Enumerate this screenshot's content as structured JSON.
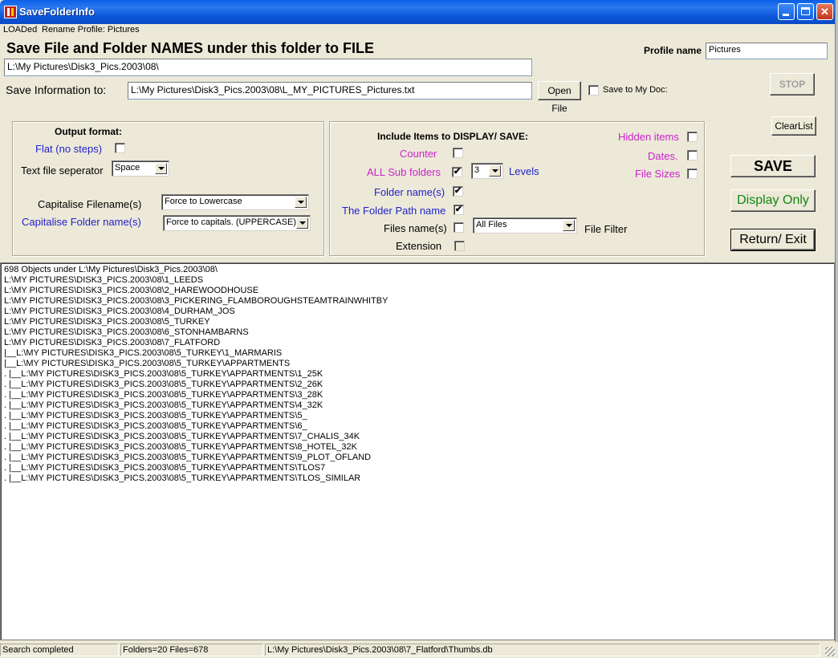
{
  "window": {
    "title": "SaveFolderInfo"
  },
  "menu": {
    "items": [
      "LOADed",
      "Rename Profile: Pictures"
    ]
  },
  "header": {
    "big_title": "Save File and Folder NAMES under this folder to FILE",
    "folder_path": "L:\\My Pictures\\Disk3_Pics.2003\\08\\",
    "save_info_label": "Save  Information to:",
    "save_info_value": "L:\\My Pictures\\Disk3_Pics.2003\\08\\L_MY_PICTURES_Pictures.txt",
    "open_file_label": "Open File",
    "save_to_mydoc_label": "Save to My Doc:",
    "profile_name_label": "Profile name",
    "profile_name_value": "Pictures"
  },
  "buttons": {
    "stop": "STOP",
    "clear_list": "ClearList",
    "save": "SAVE",
    "display_only": "Display Only",
    "return_exit": "Return/ Exit"
  },
  "output_format": {
    "heading": "Output format:",
    "flat_label": "Flat (no steps)",
    "separator_label": "Text file seperator",
    "separator_value": "Space",
    "cap_filename_label": "Capitalise Filename(s)",
    "cap_filename_value": "Force to Lowercase",
    "cap_folder_label": "Capitalise Folder name(s)",
    "cap_folder_value": "Force to capitals. (UPPERCASE)"
  },
  "include_items": {
    "heading": "Include Items to DISPLAY/ SAVE:",
    "counter_label": "Counter",
    "subfolders_label": "ALL  Sub folders",
    "levels_value": "3",
    "levels_label": "Levels",
    "folder_names_label": "Folder name(s)",
    "folder_path_label": "The Folder Path name",
    "file_names_label": "Files name(s)",
    "file_filter_value": "All Files",
    "file_filter_label": "File Filter",
    "extension_label": "Extension",
    "hidden_label": "Hidden items",
    "dates_label": "Dates.",
    "file_sizes_label": "File Sizes",
    "checkmark": "✔"
  },
  "list": {
    "lines": [
      "698 Objects under L:\\My Pictures\\Disk3_Pics.2003\\08\\",
      "L:\\MY PICTURES\\DISK3_PICS.2003\\08\\1_LEEDS",
      "L:\\MY PICTURES\\DISK3_PICS.2003\\08\\2_HAREWOODHOUSE",
      "L:\\MY PICTURES\\DISK3_PICS.2003\\08\\3_PICKERING_FLAMBOROUGHSTEAMTRAINWHITBY",
      "L:\\MY PICTURES\\DISK3_PICS.2003\\08\\4_DURHAM_JOS",
      "L:\\MY PICTURES\\DISK3_PICS.2003\\08\\5_TURKEY",
      "L:\\MY PICTURES\\DISK3_PICS.2003\\08\\6_STONHAMBARNS",
      "L:\\MY PICTURES\\DISK3_PICS.2003\\08\\7_FLATFORD",
      "|__L:\\MY PICTURES\\DISK3_PICS.2003\\08\\5_TURKEY\\1_MARMARIS",
      "|__L:\\MY PICTURES\\DISK3_PICS.2003\\08\\5_TURKEY\\APPARTMENTS",
      ". |__L:\\MY PICTURES\\DISK3_PICS.2003\\08\\5_TURKEY\\APPARTMENTS\\1_25K",
      ". |__L:\\MY PICTURES\\DISK3_PICS.2003\\08\\5_TURKEY\\APPARTMENTS\\2_26K",
      ". |__L:\\MY PICTURES\\DISK3_PICS.2003\\08\\5_TURKEY\\APPARTMENTS\\3_28K",
      ". |__L:\\MY PICTURES\\DISK3_PICS.2003\\08\\5_TURKEY\\APPARTMENTS\\4_32K",
      ". |__L:\\MY PICTURES\\DISK3_PICS.2003\\08\\5_TURKEY\\APPARTMENTS\\5_",
      ". |__L:\\MY PICTURES\\DISK3_PICS.2003\\08\\5_TURKEY\\APPARTMENTS\\6_",
      ". |__L:\\MY PICTURES\\DISK3_PICS.2003\\08\\5_TURKEY\\APPARTMENTS\\7_CHALIS_34K",
      ". |__L:\\MY PICTURES\\DISK3_PICS.2003\\08\\5_TURKEY\\APPARTMENTS\\8_HOTEL_32K",
      ". |__L:\\MY PICTURES\\DISK3_PICS.2003\\08\\5_TURKEY\\APPARTMENTS\\9_PLOT_OFLAND",
      ". |__L:\\MY PICTURES\\DISK3_PICS.2003\\08\\5_TURKEY\\APPARTMENTS\\TLOS7",
      ". |__L:\\MY PICTURES\\DISK3_PICS.2003\\08\\5_TURKEY\\APPARTMENTS\\TLOS_SIMILAR"
    ]
  },
  "status": {
    "message": "Search completed",
    "counts": "Folders=20  Files=678",
    "current_file": "L:\\My Pictures\\Disk3_Pics.2003\\08\\7_Flatford\\Thumbs.db"
  }
}
